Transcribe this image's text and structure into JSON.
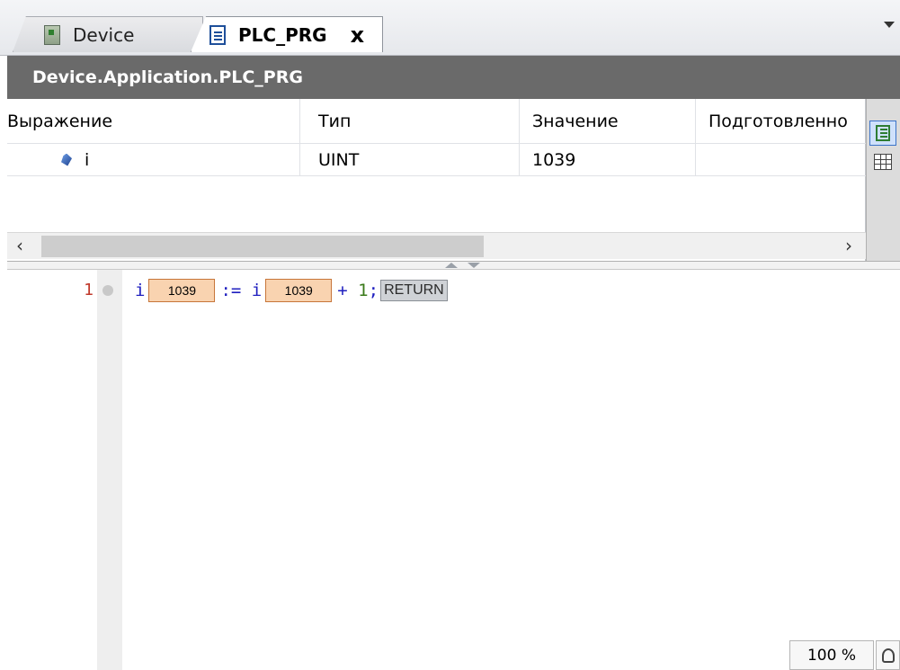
{
  "tabs": [
    {
      "label": "Device",
      "icon": "device-icon",
      "active": false
    },
    {
      "label": "PLC_PRG",
      "icon": "document-icon",
      "active": true,
      "close": "x"
    }
  ],
  "path_header": "Device.Application.PLC_PRG",
  "watch": {
    "columns": [
      "Выражение",
      "Тип",
      "Значение",
      "Подготовленное значение"
    ],
    "columns_visible": [
      "Выражение",
      "Тип",
      "Значение",
      "Подготовленно"
    ],
    "rows": [
      {
        "expression": "i",
        "type": "UINT",
        "value": "1039",
        "prepared": ""
      }
    ]
  },
  "code": {
    "line_number": "1",
    "tokens": {
      "lhs": "i",
      "lhs_value": "1039",
      "assign": ":=",
      "rhs_var": "i",
      "rhs_value": "1039",
      "op": "+",
      "literal": "1",
      "terminator": ";",
      "return_marker": "RETURN"
    }
  },
  "zoom": "100 %",
  "colors": {
    "header_bg": "#6a6a6a",
    "inline_value_bg": "#f9d3b0",
    "inline_value_border": "#c7763a",
    "keyword": "#1f1fbf",
    "line_number": "#c0392b"
  }
}
